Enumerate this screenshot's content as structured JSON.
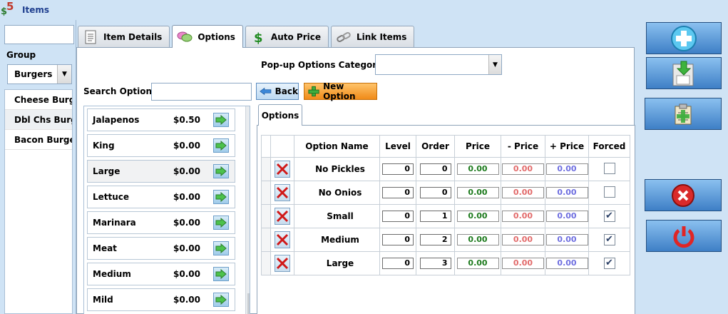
{
  "window": {
    "title": "Items"
  },
  "left": {
    "search_value": "",
    "group_label": "Group",
    "group_selected": "Burgers",
    "items": [
      "Cheese Burger",
      "Dbl Chs Burger",
      "Bacon Burger"
    ]
  },
  "tabs": [
    {
      "label": "Item Details",
      "icon": "document-icon"
    },
    {
      "label": "Options",
      "icon": "speech-bubbles-icon"
    },
    {
      "label": "Auto Price",
      "icon": "dollar-icon"
    },
    {
      "label": "Link Items",
      "icon": "chain-link-icon"
    }
  ],
  "options_tab": {
    "popup_label": "Pop-up Options Category",
    "popup_value": "",
    "search_label": "Search Options",
    "search_value": "",
    "back_label": "Back",
    "new_option_label": "New Option",
    "available_options": [
      {
        "name": "Jalapenos",
        "price": "$0.50"
      },
      {
        "name": "King",
        "price": "$0.00"
      },
      {
        "name": "Large",
        "price": "$0.00"
      },
      {
        "name": "Lettuce",
        "price": "$0.00"
      },
      {
        "name": "Marinara",
        "price": "$0.00"
      },
      {
        "name": "Meat",
        "price": "$0.00"
      },
      {
        "name": "Medium",
        "price": "$0.00"
      },
      {
        "name": "Mild",
        "price": "$0.00"
      }
    ],
    "subtab_label": "Options",
    "grid": {
      "headers": [
        "Option Name",
        "Level",
        "Order",
        "Price",
        "- Price",
        "+ Price",
        "Forced"
      ],
      "rows": [
        {
          "name": "No Pickles",
          "level": "0",
          "order": "0",
          "price": "0.00",
          "minus_price": "0.00",
          "plus_price": "0.00",
          "forced": false
        },
        {
          "name": "No Onios",
          "level": "0",
          "order": "0",
          "price": "0.00",
          "minus_price": "0.00",
          "plus_price": "0.00",
          "forced": false
        },
        {
          "name": "Small",
          "level": "0",
          "order": "1",
          "price": "0.00",
          "minus_price": "0.00",
          "plus_price": "0.00",
          "forced": true
        },
        {
          "name": "Medium",
          "level": "0",
          "order": "2",
          "price": "0.00",
          "minus_price": "0.00",
          "plus_price": "0.00",
          "forced": true
        },
        {
          "name": "Large",
          "level": "0",
          "order": "3",
          "price": "0.00",
          "minus_price": "0.00",
          "plus_price": "0.00",
          "forced": true
        }
      ]
    }
  },
  "colors": {
    "price": "#1e7b1e",
    "minus_price": "#e26a6a",
    "plus_price": "#6f6fe0"
  },
  "right_buttons": [
    "add-icon",
    "save-icon",
    "clipboard-icon",
    "cancel-icon",
    "power-icon"
  ]
}
